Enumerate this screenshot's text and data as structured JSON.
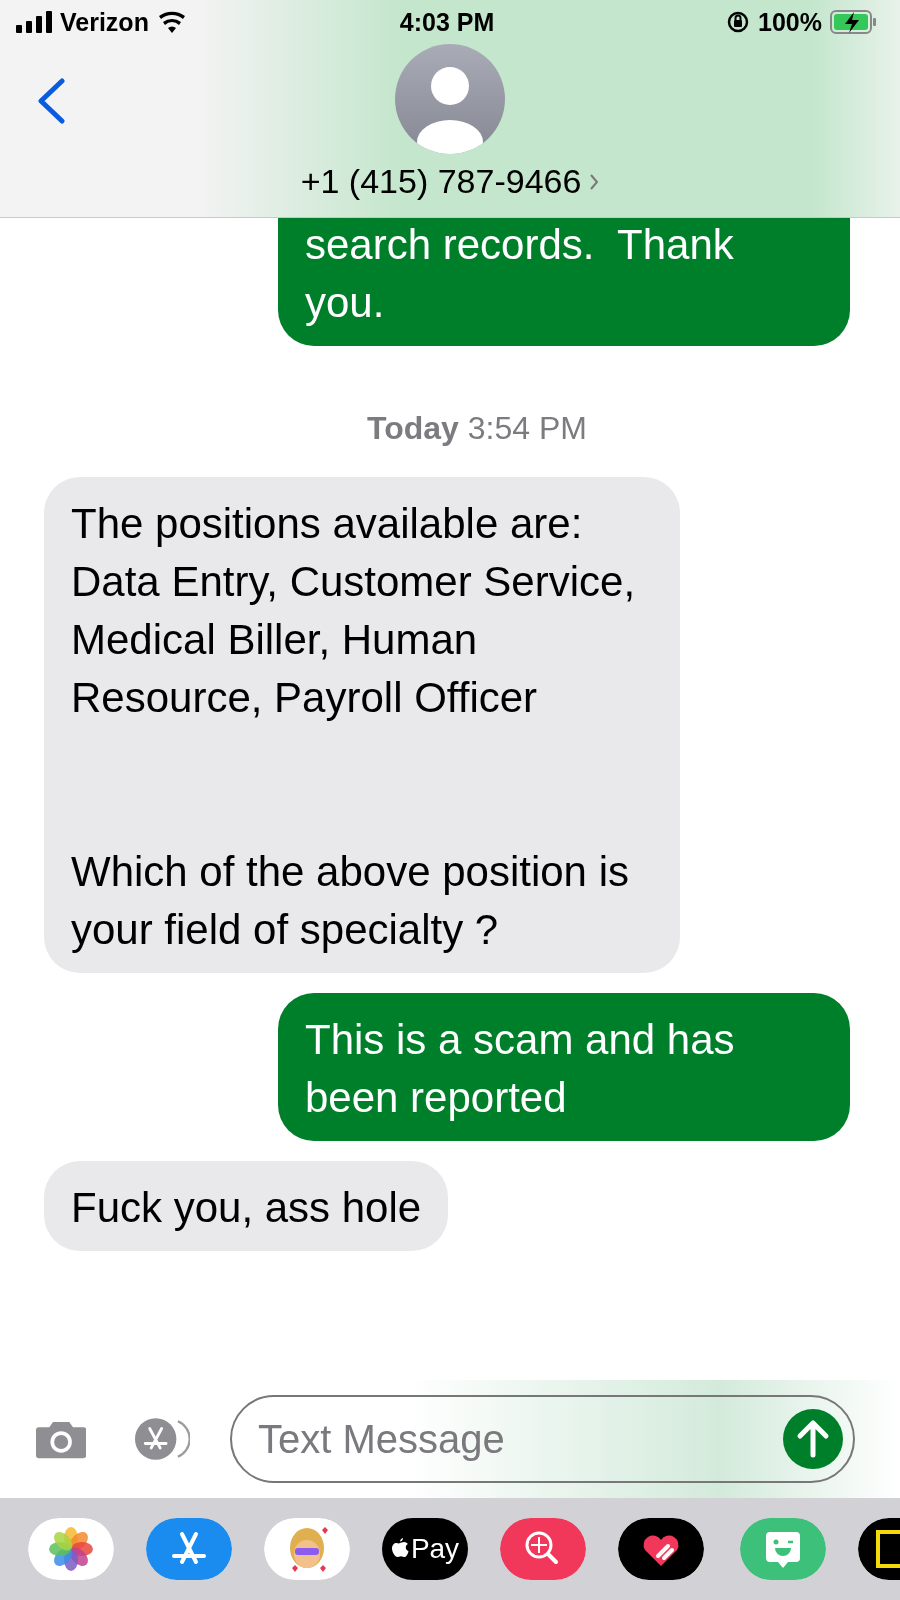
{
  "status_bar": {
    "carrier": "Verizon",
    "time": "4:03 PM",
    "battery": "100%"
  },
  "header": {
    "contact": "+1 (415) 787-9466"
  },
  "messages": [
    {
      "kind": "outgoing",
      "text": "search records.  Thank you."
    },
    {
      "kind": "timestamp",
      "text": "**Today** 3:54 PM"
    },
    {
      "kind": "incoming",
      "text": "The positions available are: Data Entry, Customer Service, Medical Biller, Human Resource, Payroll Officer\n\n\nWhich of the above position is your field of specialty ?"
    },
    {
      "kind": "outgoing",
      "text": "This is a scam and has been reported"
    },
    {
      "kind": "incoming",
      "text": "Fuck you, ass hole"
    }
  ],
  "composer": {
    "placeholder": "Text Message"
  },
  "app_drawer": [
    {
      "kind": "photos"
    },
    {
      "kind": "appstore"
    },
    {
      "kind": "memoji"
    },
    {
      "kind": "applepay",
      "label": "Pay"
    },
    {
      "kind": "search"
    },
    {
      "kind": "heart"
    },
    {
      "kind": "bitmoji"
    },
    {
      "kind": "partial"
    }
  ]
}
